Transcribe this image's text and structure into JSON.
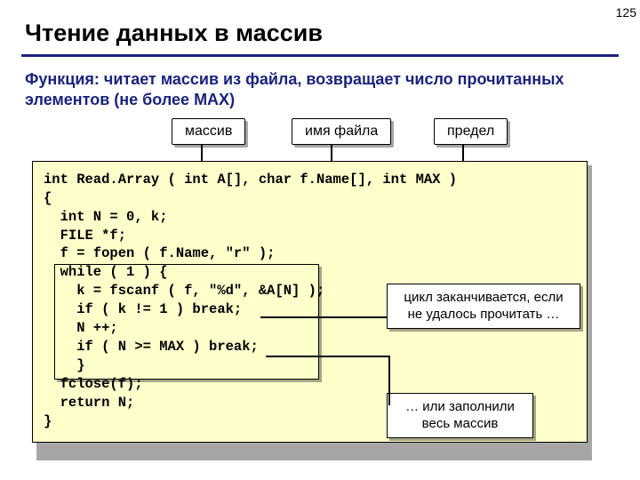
{
  "page_number": "125",
  "title": "Чтение данных в массив",
  "subtitle": "Функция: читает массив из файла, возвращает число прочитанных элементов (не более MAX)",
  "tags": {
    "array": "массив",
    "filename": "имя файла",
    "limit": "предел"
  },
  "code": "int Read.Array ( int A[], char f.Name[], int MAX )\n{\n  int N = 0, k;\n  FILE *f;\n  f = fopen ( f.Name, \"r\" );\n  while ( 1 ) {\n    k = fscanf ( f, \"%d\", &A[N] );\n    if ( k != 1 ) break;\n    N ++;\n    if ( N >= MAX ) break;\n    }\n  fclose(f);\n  return N;\n}",
  "callouts": {
    "cycle_ends": "цикл заканчивается, если не удалось прочитать …",
    "fill_array": "… или заполнили весь массив"
  }
}
